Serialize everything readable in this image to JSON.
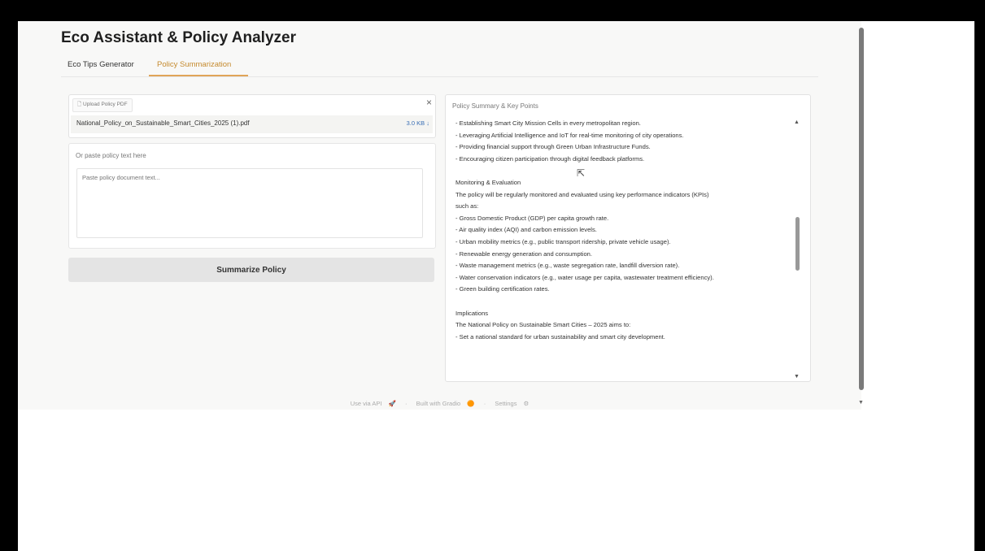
{
  "app": {
    "title": "Eco Assistant & Policy Analyzer"
  },
  "tabs": [
    {
      "label": "Eco Tips Generator",
      "active": false
    },
    {
      "label": "Policy Summarization",
      "active": true
    }
  ],
  "upload": {
    "label": "Upload Policy PDF",
    "file_name": "National_Policy_on_Sustainable_Smart_Cities_2025 (1).pdf",
    "file_size": "3.0 KB",
    "close_icon": "close-icon"
  },
  "paste": {
    "label": "Or paste policy text here",
    "placeholder": "Paste policy document text..."
  },
  "summarize_button": {
    "label": "Summarize Policy"
  },
  "summary": {
    "label": "Policy Summary & Key Points",
    "text": "- Establishing Smart City Mission Cells in every metropolitan region.\n- Leveraging Artificial Intelligence and IoT for real-time monitoring of city operations.\n- Providing financial support through Green Urban Infrastructure Funds.\n- Encouraging citizen participation through digital feedback platforms.\n\nMonitoring & Evaluation\nThe policy will be regularly monitored and evaluated using key performance indicators (KPIs)\nsuch as:\n- Gross Domestic Product (GDP) per capita growth rate.\n- Air quality index (AQI) and carbon emission levels.\n- Urban mobility metrics (e.g., public transport ridership, private vehicle usage).\n- Renewable energy generation and consumption.\n- Waste management metrics (e.g., waste segregation rate, landfill diversion rate).\n- Water conservation indicators (e.g., water usage per capita, wastewater treatment efficiency).\n- Green building certification rates.\n\nImplications\nThe National Policy on Sustainable Smart Cities – 2025 aims to:\n- Set a national standard for urban sustainability and smart city development."
  },
  "footer": {
    "api": "Use via API",
    "built": "Built with Gradio",
    "settings": "Settings",
    "sep": "·"
  },
  "colors": {
    "accent": "#e0a458",
    "link": "#3a6fb5"
  }
}
